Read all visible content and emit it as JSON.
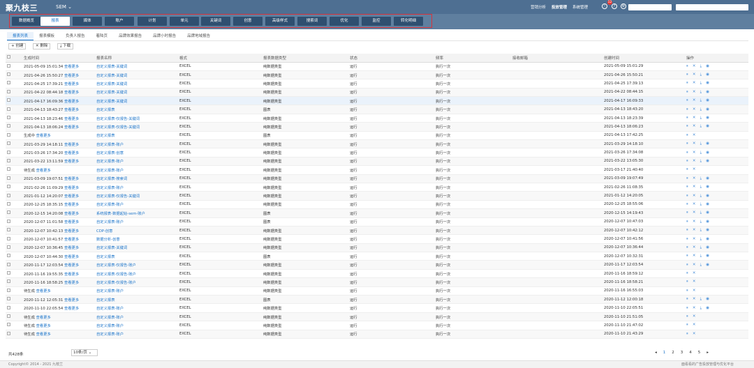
{
  "header": {
    "logo": "聚九枝三",
    "product": "SEM ⌄",
    "nav": [
      "营销分析",
      "投放管理",
      "系统管理"
    ],
    "badge": "12",
    "account_select": "",
    "user_select": ""
  },
  "main_tabs": [
    "数据概览",
    "报表",
    "媒体",
    "账户",
    "计划",
    "单元",
    "关键词",
    "创意",
    "高级样式",
    "搜索词",
    "优化",
    "监控",
    "转化明细"
  ],
  "report_tabs": [
    "报表列表",
    "报表模板",
    "负责人报告",
    "着陆页",
    "品牌效果报告",
    "品牌小时报告",
    "品牌地域报告"
  ],
  "toolbar": {
    "create": "+ 创建",
    "delete": "✕ 删除",
    "download": "⤓ 下载"
  },
  "columns": [
    "",
    "生成时间",
    "报表名称",
    "格式",
    "报表数据类型",
    "状态",
    "频率",
    "接收邮箱",
    "创建时间",
    "操作"
  ],
  "rows": [
    {
      "gen": "2021-05-09 15:01:34",
      "more": "查看更多",
      "name": "自定义报表-关键词",
      "fmt": "EXCEL",
      "type": "纯数据类型",
      "status": "运行",
      "freq": "执行一次",
      "created": "2021-05-09 15:01:29",
      "ops": "⏸ ✕ ⤓ ◉"
    },
    {
      "gen": "2021-04-26 15:50:27",
      "more": "查看更多",
      "name": "自定义报表-关键词",
      "fmt": "EXCEL",
      "type": "纯数据类型",
      "status": "运行",
      "freq": "执行一次",
      "created": "2021-04-26 15:50:21",
      "ops": "⏸ ✕ ⤓ ◉"
    },
    {
      "gen": "2021-04-25 17:39:21",
      "more": "查看更多",
      "name": "自定义报表-关键词",
      "fmt": "EXCEL",
      "type": "纯数据类型",
      "status": "运行",
      "freq": "执行一次",
      "created": "2021-04-25 17:39:13",
      "ops": "⏸ ✕ ⤓ ◉"
    },
    {
      "gen": "2021-04-22 08:44:18",
      "more": "查看更多",
      "name": "自定义报表-关键词",
      "fmt": "EXCEL",
      "type": "纯数据类型",
      "status": "运行",
      "freq": "执行一次",
      "created": "2021-04-22 08:44:15",
      "ops": "⏸ ✕ ⤓ ◉"
    },
    {
      "gen": "2021-04-17 16:09:36",
      "more": "查看更多",
      "name": "自定义报表-关键词",
      "fmt": "EXCEL",
      "type": "纯数据类型",
      "status": "运行",
      "freq": "执行一次",
      "created": "2021-04-17 16:09:33",
      "ops": "⏸ ✕ ⤓ ◉"
    },
    {
      "gen": "2021-04-13 18:43:27",
      "more": "查看更多",
      "name": "自定义报表",
      "fmt": "EXCEL",
      "type": "图表",
      "status": "运行",
      "freq": "执行一次",
      "created": "2021-04-13 18:43:20",
      "ops": "⏸ ✕ ⤓ ◉"
    },
    {
      "gen": "2021-04-13 18:23:46",
      "more": "查看更多",
      "name": "自定义报表-仅报告-关键词",
      "fmt": "EXCEL",
      "type": "纯数据类型",
      "status": "运行",
      "freq": "执行一次",
      "created": "2021-04-13 18:23:39",
      "ops": "⏸ ✕ ⤓ ◉"
    },
    {
      "gen": "2021-04-13 18:06:24",
      "more": "查看更多",
      "name": "自定义报表-仅报告-关键词",
      "fmt": "EXCEL",
      "type": "纯数据类型",
      "status": "运行",
      "freq": "执行一次",
      "created": "2021-04-13 18:06:23",
      "ops": "⏸ ✕ ⤓ ◉"
    },
    {
      "gen": "生成中",
      "more": "查看更多",
      "name": "自定义报表",
      "fmt": "EXCEL",
      "type": "图表",
      "status": "运行",
      "freq": "执行一次",
      "created": "2021-04-13 17:42:25",
      "ops": "⏸ ✕"
    },
    {
      "gen": "2021-03-29 14:18:11",
      "more": "查看更多",
      "name": "自定义报表-账户",
      "fmt": "EXCEL",
      "type": "纯数据类型",
      "status": "运行",
      "freq": "执行一次",
      "created": "2021-03-29 14:18:10",
      "ops": "⏸ ✕ ⤓ ◉"
    },
    {
      "gen": "2021-03-26 17:34:20",
      "more": "查看更多",
      "name": "自定义报表-创意",
      "fmt": "EXCEL",
      "type": "纯数据类型",
      "status": "运行",
      "freq": "执行一次",
      "created": "2021-03-26 17:34:08",
      "ops": "⏸ ✕ ⤓ ◉"
    },
    {
      "gen": "2021-03-22 13:11:59",
      "more": "查看更多",
      "name": "自定义报表-账户",
      "fmt": "EXCEL",
      "type": "纯数据类型",
      "status": "运行",
      "freq": "执行一次",
      "created": "2021-03-22 13:05:30",
      "ops": "⏸ ✕ ⤓ ◉"
    },
    {
      "gen": "待生成",
      "more": "查看更多",
      "name": "自定义报表-账户",
      "fmt": "EXCEL",
      "type": "纯数据类型",
      "status": "运行",
      "freq": "执行一次",
      "created": "2021-03-17 21:40:40",
      "ops": "⏸ ✕"
    },
    {
      "gen": "2021-03-09 19:07:51",
      "more": "查看更多",
      "name": "自定义报表-搜索词",
      "fmt": "EXCEL",
      "type": "纯数据类型",
      "status": "运行",
      "freq": "执行一次",
      "created": "2021-03-09 19:07:49",
      "ops": "⏸ ✕ ⤓ ◉"
    },
    {
      "gen": "2021-02-26 11:09:29",
      "more": "查看更多",
      "name": "自定义报表-账户",
      "fmt": "EXCEL",
      "type": "纯数据类型",
      "status": "运行",
      "freq": "执行一次",
      "created": "2021-02-26 11:08:35",
      "ops": "⏸ ✕ ⤓ ◉"
    },
    {
      "gen": "2021-01-12 14:20:07",
      "more": "查看更多",
      "name": "自定义报表-仅报告-关键词",
      "fmt": "EXCEL",
      "type": "纯数据类型",
      "status": "运行",
      "freq": "执行一次",
      "created": "2021-01-12 14:20:05",
      "ops": "⏸ ✕ ⤓ ◉"
    },
    {
      "gen": "2020-12-25 18:35:15",
      "more": "查看更多",
      "name": "自定义报表-账户",
      "fmt": "EXCEL",
      "type": "纯数据类型",
      "status": "运行",
      "freq": "执行一次",
      "created": "2020-12-25 18:55:06",
      "ops": "⏸ ✕ ⤓ ◉"
    },
    {
      "gen": "2020-12-15 14:20:08",
      "more": "查看更多",
      "name": "系统报表-数据起始-sem-账户",
      "fmt": "EXCEL",
      "type": "图表",
      "status": "运行",
      "freq": "执行一次",
      "created": "2020-12-15 14:19:43",
      "ops": "⏸ ✕ ⤓ ◉"
    },
    {
      "gen": "2020-12-07 11:01:58",
      "more": "查看更多",
      "name": "自定义报表-账户",
      "fmt": "EXCEL",
      "type": "图表",
      "status": "运行",
      "freq": "执行一次",
      "created": "2020-12-07 10:47:03",
      "ops": "⏸ ✕ ⤓ ◉"
    },
    {
      "gen": "2020-12-07 10:42:13",
      "more": "查看更多",
      "name": "CDP-创意",
      "fmt": "EXCEL",
      "type": "纯数据类型",
      "status": "运行",
      "freq": "执行一次",
      "created": "2020-12-07 10:42:12",
      "ops": "⏸ ✕ ⤓ ◉"
    },
    {
      "gen": "2020-12-07 10:41:57",
      "more": "查看更多",
      "name": "数据分析-创意",
      "fmt": "EXCEL",
      "type": "纯数据类型",
      "status": "运行",
      "freq": "执行一次",
      "created": "2020-12-07 10:41:56",
      "ops": "⏸ ✕ ⤓ ◉"
    },
    {
      "gen": "2020-12-07 10:36:45",
      "more": "查看更多",
      "name": "自定义报表-关键词",
      "fmt": "EXCEL",
      "type": "纯数据类型",
      "status": "运行",
      "freq": "执行一次",
      "created": "2020-12-07 10:36:44",
      "ops": "⏸ ✕ ⤓ ◉"
    },
    {
      "gen": "2020-12-07 10:44:30",
      "more": "查看更多",
      "name": "自定义报表",
      "fmt": "EXCEL",
      "type": "图表",
      "status": "运行",
      "freq": "执行一次",
      "created": "2020-12-07 10:32:31",
      "ops": "⏸ ✕ ⤓ ◉"
    },
    {
      "gen": "2020-11-17 12:03:54",
      "more": "查看更多",
      "name": "自定义报表-仅报告-账户",
      "fmt": "EXCEL",
      "type": "纯数据类型",
      "status": "运行",
      "freq": "执行一次",
      "created": "2020-11-17 12:03:54",
      "ops": "⏸ ✕ ⤓ ◉"
    },
    {
      "gen": "2020-11-16 19:55:35",
      "more": "查看更多",
      "name": "自定义报表-仅报告-账户",
      "fmt": "EXCEL",
      "type": "纯数据类型",
      "status": "运行",
      "freq": "执行一次",
      "created": "2020-11-16 18:59:12",
      "ops": "⏸ ✕"
    },
    {
      "gen": "2020-11-16 18:58:25",
      "more": "查看更多",
      "name": "自定义报表-仅报告-账户",
      "fmt": "EXCEL",
      "type": "纯数据类型",
      "status": "运行",
      "freq": "执行一次",
      "created": "2020-11-16 18:58:21",
      "ops": "⏸ ✕"
    },
    {
      "gen": "待生成",
      "more": "查看更多",
      "name": "自定义报表-账户",
      "fmt": "EXCEL",
      "type": "纯数据类型",
      "status": "运行",
      "freq": "执行一次",
      "created": "2020-11-16 16:55:03",
      "ops": "⏸ ✕"
    },
    {
      "gen": "2020-11-12 12:05:31",
      "more": "查看更多",
      "name": "自定义报表",
      "fmt": "EXCEL",
      "type": "图表",
      "status": "运行",
      "freq": "执行一次",
      "created": "2020-11-12 12:00:18",
      "ops": "⏸ ✕ ⤓ ◉"
    },
    {
      "gen": "2020-11-10 22:05:54",
      "more": "查看更多",
      "name": "自定义报表-账户",
      "fmt": "EXCEL",
      "type": "纯数据类型",
      "status": "运行",
      "freq": "执行一次",
      "created": "2020-11-10 22:05:51",
      "ops": "⏸ ✕ ⤓ ◉"
    },
    {
      "gen": "待生成",
      "more": "查看更多",
      "name": "自定义报表-账户",
      "fmt": "EXCEL",
      "type": "纯数据类型",
      "status": "运行",
      "freq": "执行一次",
      "created": "2020-11-10 21:51:05",
      "ops": "⏸ ✕"
    },
    {
      "gen": "待生成",
      "more": "查看更多",
      "name": "自定义报表-账户",
      "fmt": "EXCEL",
      "type": "纯数据类型",
      "status": "运行",
      "freq": "执行一次",
      "created": "2020-11-10 21:47:02",
      "ops": "⏸ ✕"
    },
    {
      "gen": "待生成",
      "more": "查看更多",
      "name": "自定义报表-账户",
      "fmt": "EXCEL",
      "type": "纯数据类型",
      "status": "运行",
      "freq": "执行一次",
      "created": "2020-11-10 21:43:29",
      "ops": "⏸ ✕"
    }
  ],
  "footer": {
    "total": "共428条",
    "page_size": "10条/页 ⌄",
    "pager": [
      "◂",
      "1",
      "2",
      "3",
      "4",
      "5",
      "▸"
    ],
    "copyright": "Copyright© 2014 - 2021 九枝兰",
    "right_text": "面看看的广告投放管理与优化平台"
  },
  "colors": {
    "topbar": "#4e6f92",
    "tab_bg": "#2f4f70",
    "link": "#1a73c9",
    "highlight_border": "#d9333a"
  }
}
